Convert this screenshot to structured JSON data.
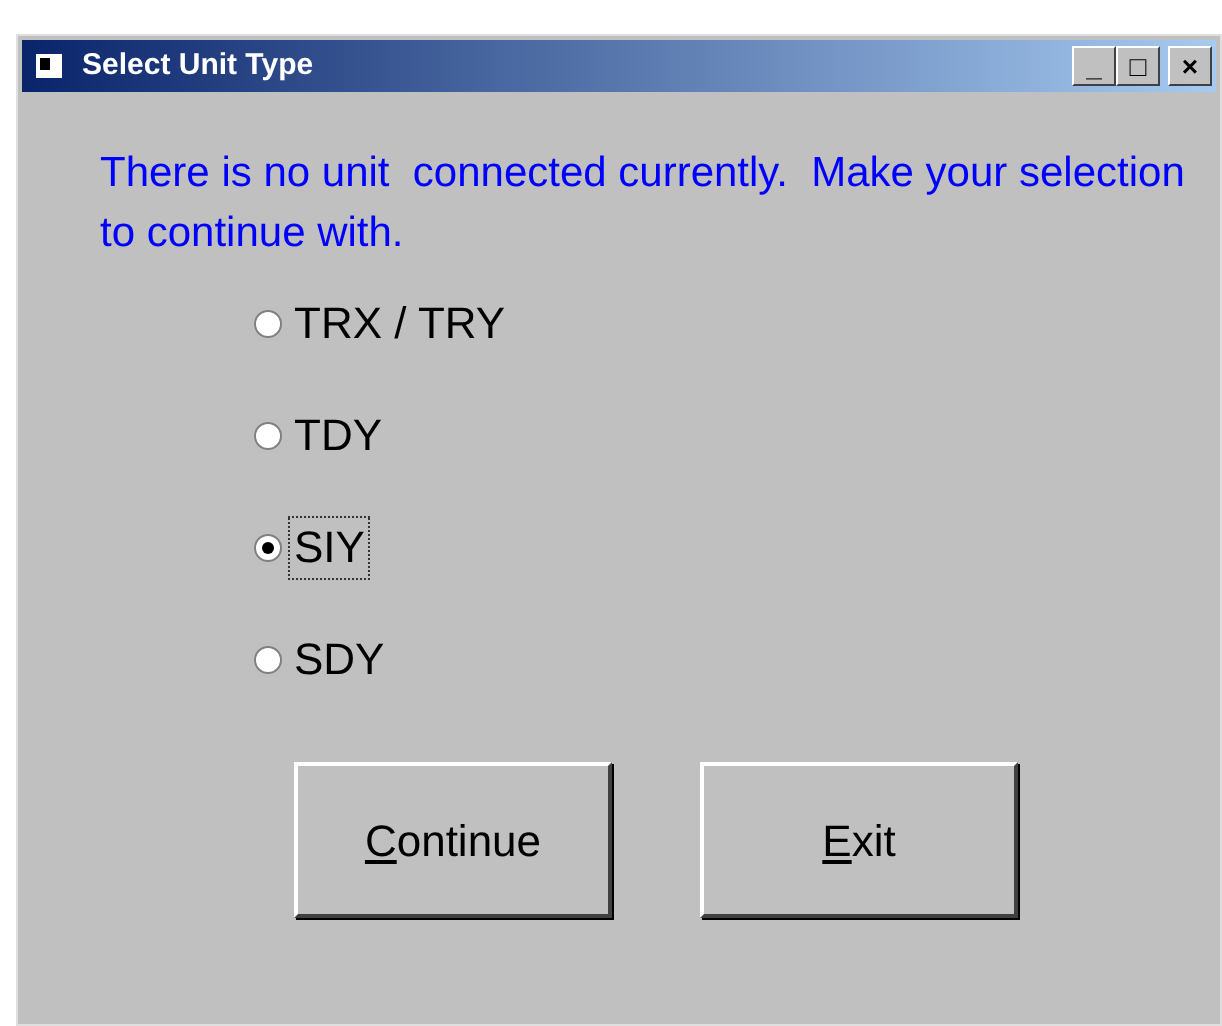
{
  "window": {
    "title": "Select Unit Type",
    "controls": [
      "_",
      "□",
      "×"
    ]
  },
  "message": "There is no unit  connected currently.  Make your selection to continue with.",
  "options": [
    {
      "label": "TRX / TRY",
      "selected": false
    },
    {
      "label": "TDY",
      "selected": false
    },
    {
      "label": "SIY",
      "selected": true
    },
    {
      "label": "SDY",
      "selected": false
    }
  ],
  "buttons": [
    {
      "key": "C",
      "rest": "ontinue"
    },
    {
      "key": "E",
      "rest": "xit"
    }
  ]
}
